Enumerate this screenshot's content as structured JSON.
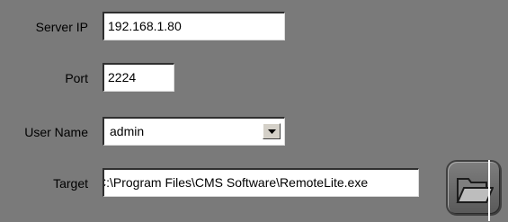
{
  "form": {
    "server_ip": {
      "label": "Server IP",
      "value": "192.168.1.80"
    },
    "port": {
      "label": "Port",
      "value": "2224"
    },
    "user_name": {
      "label": "User Name",
      "selected": "admin"
    },
    "target": {
      "label": "Target",
      "value": "C:\\Program Files\\CMS Software\\RemoteLite.exe"
    }
  },
  "icons": {
    "dropdown_arrow": "chevron-down-icon",
    "browse": "folder-open-icon"
  },
  "colors": {
    "background": "#7a7a7a",
    "field_background": "#ffffff",
    "button_face": "#d4d0c8"
  }
}
